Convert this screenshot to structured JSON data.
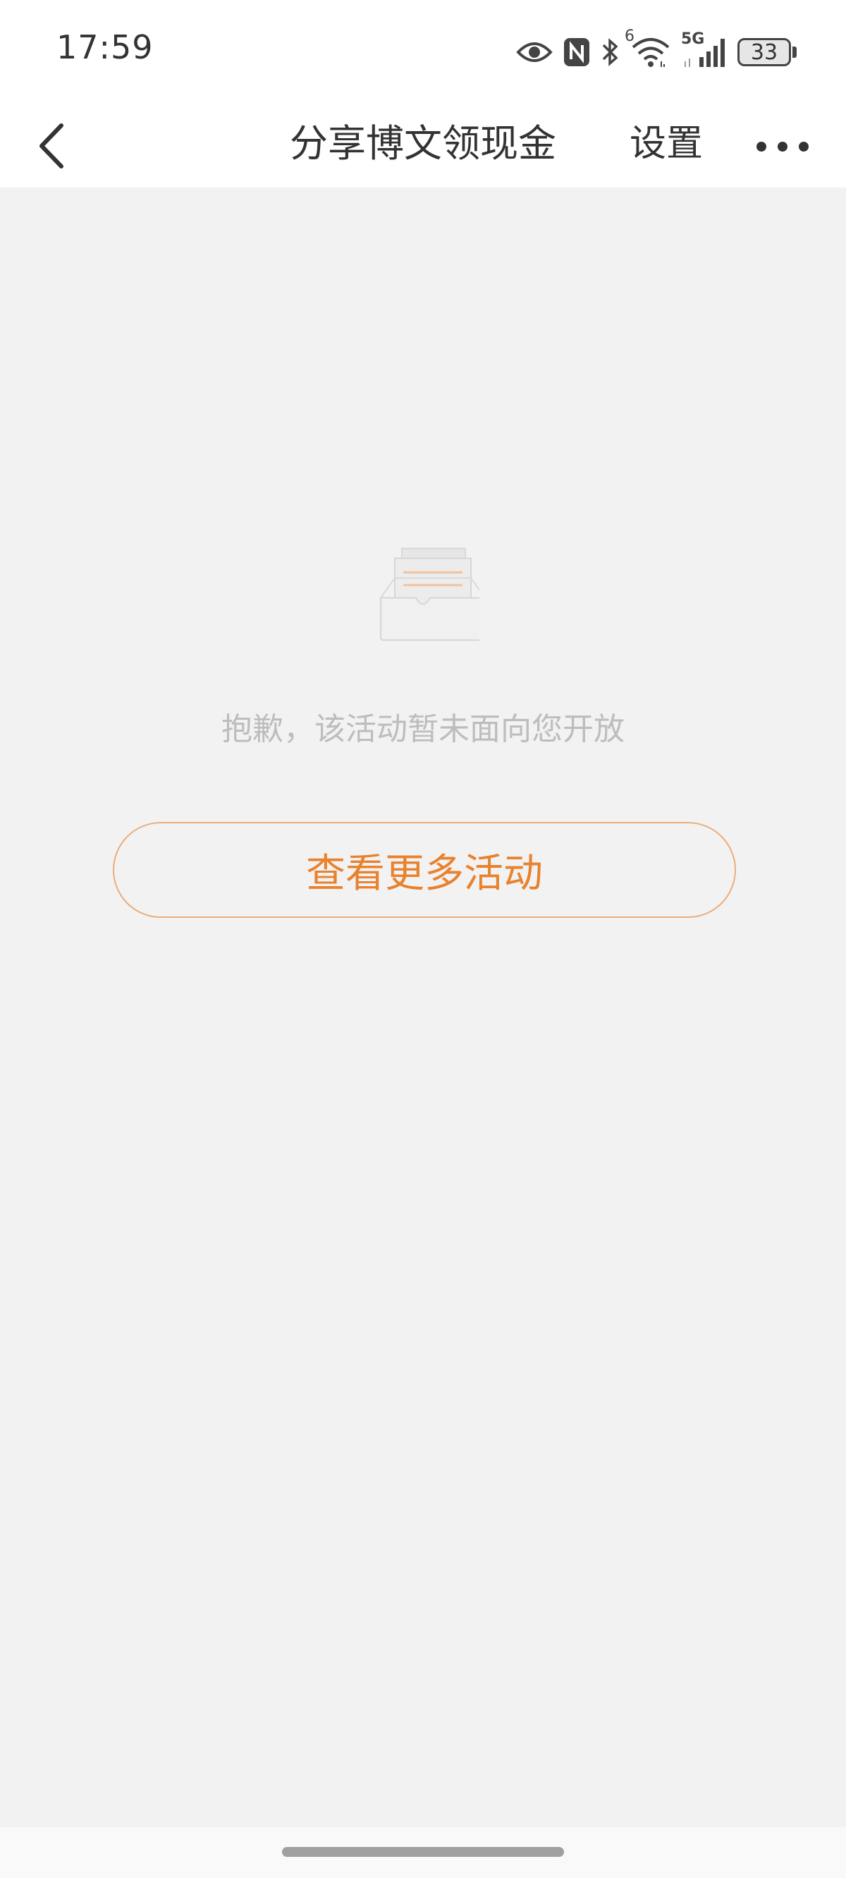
{
  "status_bar": {
    "time": "17:59",
    "battery": "33",
    "network": "5G",
    "sim_slot": "6",
    "icons": [
      "eye-icon",
      "nfc-icon",
      "bluetooth-icon",
      "wifi-icon",
      "signal-icon",
      "battery-icon"
    ]
  },
  "nav": {
    "title": "分享博文领现金",
    "settings_label": "设置",
    "back_icon": "chevron-left-icon",
    "more_icon": "more-dots-icon"
  },
  "empty_state": {
    "illustration_icon": "empty-inbox-icon",
    "message": "抱歉，该活动暂未面向您开放",
    "button_label": "查看更多活动"
  },
  "colors": {
    "accent": "#e8822e",
    "button_border": "#ebae7b",
    "background": "#f2f2f2",
    "header_bg": "#ffffff",
    "message_text": "#bdbdbd",
    "title_text": "#333333"
  }
}
